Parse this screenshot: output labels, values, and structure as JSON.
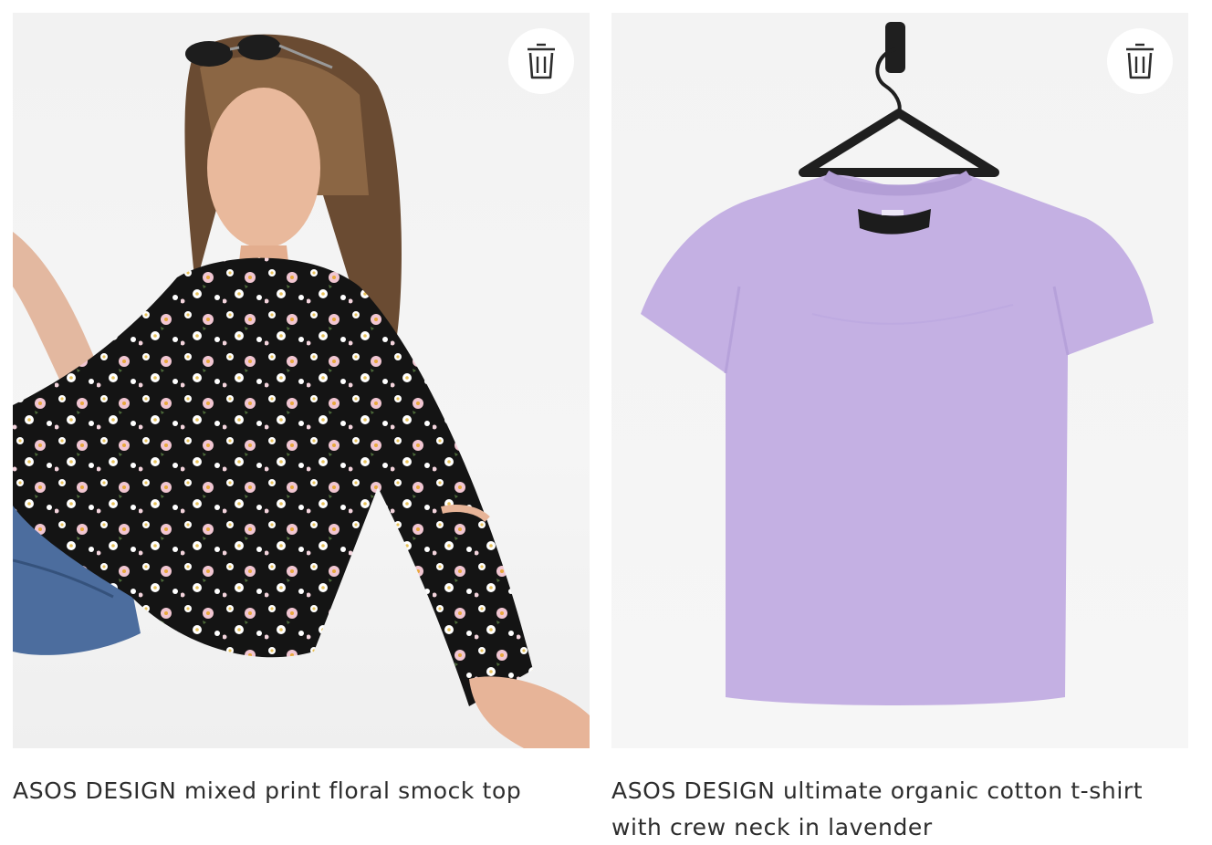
{
  "products": [
    {
      "title": "ASOS DESIGN mixed print floral smock top",
      "image_icon": "product-photo-floral-smock-top",
      "delete_icon": "trash-icon"
    },
    {
      "title": "ASOS DESIGN ultimate organic cotton t-shirt with crew neck in lavender",
      "image_icon": "product-photo-lavender-tshirt",
      "delete_icon": "trash-icon"
    }
  ],
  "colors": {
    "text": "#2d2d2d",
    "tshirt": "#c4b0e3",
    "floral_base": "#141414"
  }
}
